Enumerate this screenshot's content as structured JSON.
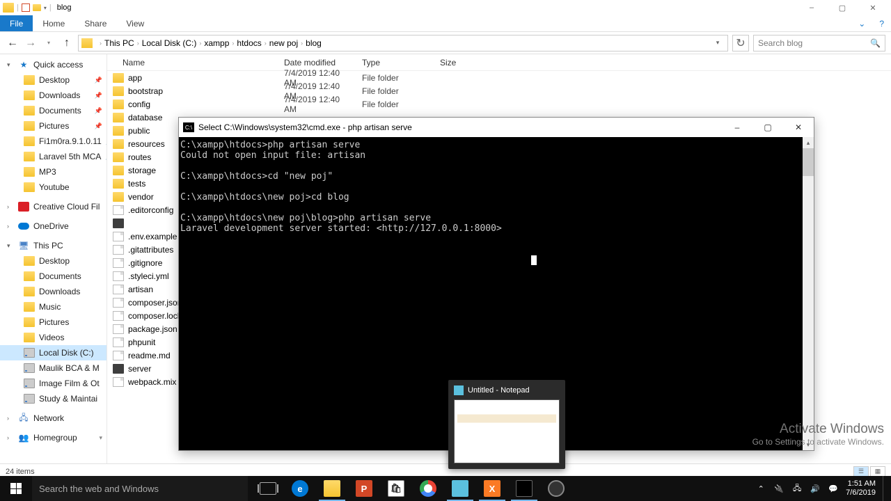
{
  "titlebar": {
    "title": "blog"
  },
  "win_controls": {
    "min": "–",
    "max": "▢",
    "close": "✕"
  },
  "ribbon": {
    "file": "File",
    "tabs": [
      "Home",
      "Share",
      "View"
    ]
  },
  "breadcrumb": [
    "This PC",
    "Local Disk (C:)",
    "xampp",
    "htdocs",
    "new poj",
    "blog"
  ],
  "search": {
    "placeholder": "Search blog"
  },
  "columns": {
    "name": "Name",
    "date": "Date modified",
    "type": "Type",
    "size": "Size"
  },
  "sidebar": {
    "quick": {
      "label": "Quick access",
      "items": [
        {
          "label": "Desktop",
          "icon": "folder",
          "pin": true
        },
        {
          "label": "Downloads",
          "icon": "folder",
          "pin": true
        },
        {
          "label": "Documents",
          "icon": "folder",
          "pin": true
        },
        {
          "label": "Pictures",
          "icon": "folder",
          "pin": true
        },
        {
          "label": "Fi1m0ra.9.1.0.11",
          "icon": "folder",
          "pin": true
        },
        {
          "label": "Laravel 5th MCA",
          "icon": "folder",
          "pin": true
        },
        {
          "label": "MP3",
          "icon": "folder"
        },
        {
          "label": "Youtube",
          "icon": "folder"
        }
      ]
    },
    "creative": "Creative Cloud Fil",
    "onedrive": "OneDrive",
    "thispc": {
      "label": "This PC",
      "items": [
        {
          "label": "Desktop"
        },
        {
          "label": "Documents"
        },
        {
          "label": "Downloads"
        },
        {
          "label": "Music"
        },
        {
          "label": "Pictures"
        },
        {
          "label": "Videos"
        },
        {
          "label": "Local Disk (C:)",
          "sel": true,
          "icon": "drive"
        },
        {
          "label": "Maulik BCA & M",
          "icon": "drive"
        },
        {
          "label": "Image Film & Ot",
          "icon": "drive"
        },
        {
          "label": "Study & Maintai",
          "icon": "drive"
        }
      ]
    },
    "network": "Network",
    "homegroup": "Homegroup"
  },
  "files": [
    {
      "name": "app",
      "date": "7/4/2019 12:40 AM",
      "type": "File folder",
      "icon": "folder"
    },
    {
      "name": "bootstrap",
      "date": "7/4/2019 12:40 AM",
      "type": "File folder",
      "icon": "folder"
    },
    {
      "name": "config",
      "date": "7/4/2019 12:40 AM",
      "type": "File folder",
      "icon": "folder"
    },
    {
      "name": "database",
      "date": "",
      "type": "",
      "icon": "folder"
    },
    {
      "name": "public",
      "date": "",
      "type": "",
      "icon": "folder"
    },
    {
      "name": "resources",
      "date": "",
      "type": "",
      "icon": "folder"
    },
    {
      "name": "routes",
      "date": "",
      "type": "",
      "icon": "folder"
    },
    {
      "name": "storage",
      "date": "",
      "type": "",
      "icon": "folder"
    },
    {
      "name": "tests",
      "date": "",
      "type": "",
      "icon": "folder"
    },
    {
      "name": "vendor",
      "date": "",
      "type": "",
      "icon": "folder"
    },
    {
      "name": ".editorconfig",
      "date": "",
      "type": "",
      "icon": "file"
    },
    {
      "name": "",
      "date": "",
      "type": "",
      "icon": "sublime"
    },
    {
      "name": ".env.example",
      "date": "",
      "type": "",
      "icon": "file"
    },
    {
      "name": ".gitattributes",
      "date": "",
      "type": "",
      "icon": "file"
    },
    {
      "name": ".gitignore",
      "date": "",
      "type": "",
      "icon": "file"
    },
    {
      "name": ".styleci.yml",
      "date": "",
      "type": "",
      "icon": "file"
    },
    {
      "name": "artisan",
      "date": "",
      "type": "",
      "icon": "file"
    },
    {
      "name": "composer.json",
      "date": "",
      "type": "",
      "icon": "file"
    },
    {
      "name": "composer.lock",
      "date": "",
      "type": "",
      "icon": "file"
    },
    {
      "name": "package.json",
      "date": "",
      "type": "",
      "icon": "file"
    },
    {
      "name": "phpunit",
      "date": "",
      "type": "",
      "icon": "file"
    },
    {
      "name": "readme.md",
      "date": "",
      "type": "",
      "icon": "file"
    },
    {
      "name": "server",
      "date": "",
      "type": "",
      "icon": "sublime"
    },
    {
      "name": "webpack.mix",
      "date": "",
      "type": "",
      "icon": "file"
    }
  ],
  "status": {
    "count": "24 items"
  },
  "cmd": {
    "title": "Select C:\\Windows\\system32\\cmd.exe - php  artisan serve",
    "lines": "C:\\xampp\\htdocs>php artisan serve\nCould not open input file: artisan\n\nC:\\xampp\\htdocs>cd \"new poj\"\n\nC:\\xampp\\htdocs\\new poj>cd blog\n\nC:\\xampp\\htdocs\\new poj\\blog>php artisan serve\nLaravel development server started: <http://127.0.0.1:8000>\n"
  },
  "thumb": {
    "title": "Untitled - Notepad"
  },
  "watermark": {
    "line1": "Activate Windows",
    "line2": "Go to Settings to activate Windows."
  },
  "taskbar": {
    "search": "Search the web and Windows",
    "time": "1:51 AM",
    "date": "7/6/2019"
  }
}
